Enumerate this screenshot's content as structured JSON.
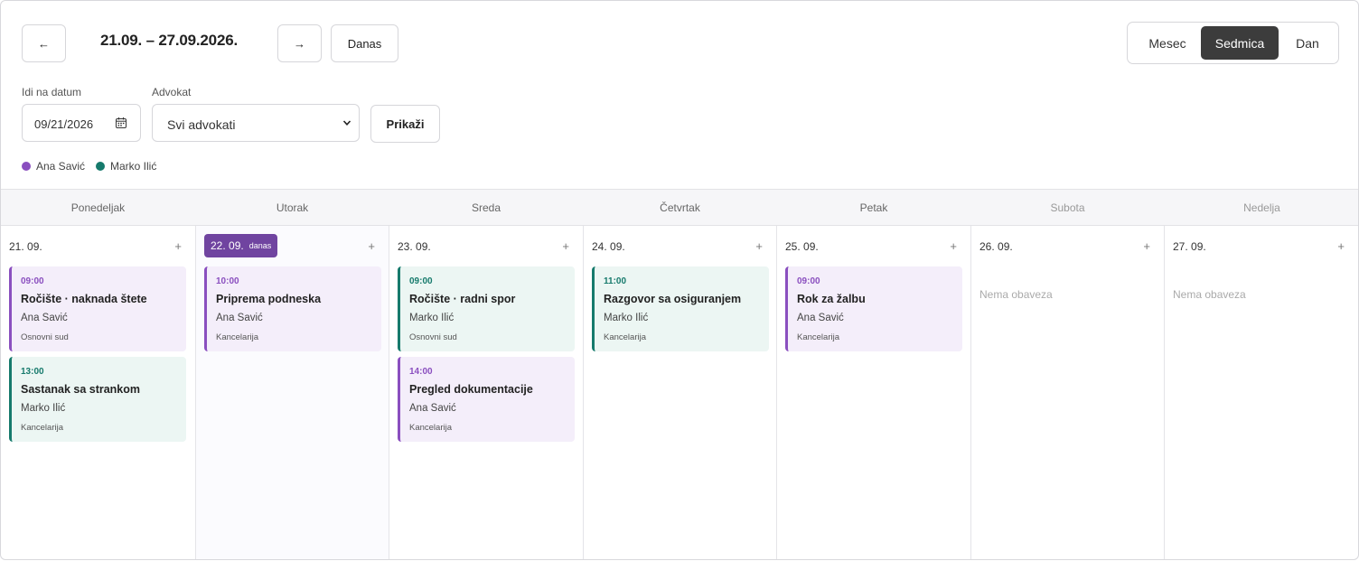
{
  "nav": {
    "prev_label": "←",
    "next_label": "→",
    "today_label": "Danas",
    "range": "21.09. – 27.09.2026."
  },
  "views": [
    {
      "label": "Mesec",
      "active": false
    },
    {
      "label": "Sedmica",
      "active": true
    },
    {
      "label": "Dan",
      "active": false
    }
  ],
  "filters": {
    "date_label": "Idi na datum",
    "date_value": "09/21/2026",
    "lawyer_label": "Advokat",
    "lawyer_value": "Svi advokati",
    "submit_label": "Prikaži"
  },
  "legend": [
    {
      "name": "Ana Savić",
      "color": "#8a4fbf"
    },
    {
      "name": "Marko Ilić",
      "color": "#167a6c"
    }
  ],
  "colors": {
    "accent": "#7044a0",
    "purple": "#8a4fbf",
    "teal": "#167a6c"
  },
  "days": [
    {
      "dow": "Ponedeljak",
      "date": "21. 09."
    },
    {
      "dow": "Utorak",
      "date": "22. 09.",
      "today_tag": "danas"
    },
    {
      "dow": "Sreda",
      "date": "23. 09."
    },
    {
      "dow": "Četvrtak",
      "date": "24. 09."
    },
    {
      "dow": "Petak",
      "date": "25. 09."
    },
    {
      "dow": "Subota",
      "date": "26. 09.",
      "empty": "Nema obaveza"
    },
    {
      "dow": "Nedelja",
      "date": "27. 09.",
      "empty": "Nema obaveza"
    }
  ],
  "add_label": "+",
  "events": [
    [
      {
        "time": "09:00",
        "title": "Ročište · naknada štete",
        "person": "Ana Savić",
        "place": "Osnovni sud"
      },
      {
        "time": "13:00",
        "title": "Sastanak sa strankom",
        "person": "Marko Ilić",
        "place": "Kancelarija"
      }
    ],
    [
      {
        "time": "10:00",
        "title": "Priprema podneska",
        "person": "Ana Savić",
        "place": "Kancelarija"
      }
    ],
    [
      {
        "time": "09:00",
        "title": "Ročište · radni spor",
        "person": "Marko Ilić",
        "place": "Osnovni sud"
      },
      {
        "time": "14:00",
        "title": "Pregled dokumentacije",
        "person": "Ana Savić",
        "place": "Kancelarija"
      }
    ],
    [
      {
        "time": "11:00",
        "title": "Razgovor sa osiguranjem",
        "person": "Marko Ilić",
        "place": "Kancelarija"
      }
    ],
    [
      {
        "time": "09:00",
        "title": "Rok za žalbu",
        "person": "Ana Savić",
        "place": "Kancelarija"
      }
    ]
  ]
}
